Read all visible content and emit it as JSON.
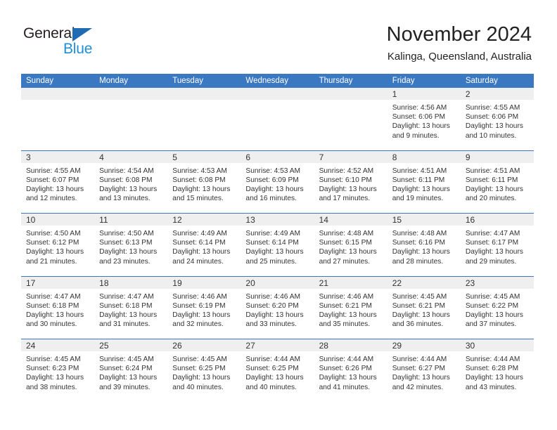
{
  "brand": {
    "name_top": "General",
    "name_bottom": "Blue",
    "triangle_icon": "brand-triangle-icon",
    "color_dark": "#231f20",
    "color_blue": "#1f8fd8"
  },
  "header": {
    "title": "November 2024",
    "subtitle": "Kalinga, Queensland, Australia"
  },
  "theme": {
    "header_blue": "#3a78c2",
    "date_strip_gray": "#efefef",
    "text": "#333333"
  },
  "weekdays": [
    "Sunday",
    "Monday",
    "Tuesday",
    "Wednesday",
    "Thursday",
    "Friday",
    "Saturday"
  ],
  "weeks": [
    [
      {
        "day": "",
        "empty": true
      },
      {
        "day": "",
        "empty": true
      },
      {
        "day": "",
        "empty": true
      },
      {
        "day": "",
        "empty": true
      },
      {
        "day": "",
        "empty": true
      },
      {
        "day": "1",
        "sunrise": "Sunrise: 4:56 AM",
        "sunset": "Sunset: 6:06 PM",
        "daylight": "Daylight: 13 hours and 9 minutes."
      },
      {
        "day": "2",
        "sunrise": "Sunrise: 4:55 AM",
        "sunset": "Sunset: 6:06 PM",
        "daylight": "Daylight: 13 hours and 10 minutes."
      }
    ],
    [
      {
        "day": "3",
        "sunrise": "Sunrise: 4:55 AM",
        "sunset": "Sunset: 6:07 PM",
        "daylight": "Daylight: 13 hours and 12 minutes."
      },
      {
        "day": "4",
        "sunrise": "Sunrise: 4:54 AM",
        "sunset": "Sunset: 6:08 PM",
        "daylight": "Daylight: 13 hours and 13 minutes."
      },
      {
        "day": "5",
        "sunrise": "Sunrise: 4:53 AM",
        "sunset": "Sunset: 6:08 PM",
        "daylight": "Daylight: 13 hours and 15 minutes."
      },
      {
        "day": "6",
        "sunrise": "Sunrise: 4:53 AM",
        "sunset": "Sunset: 6:09 PM",
        "daylight": "Daylight: 13 hours and 16 minutes."
      },
      {
        "day": "7",
        "sunrise": "Sunrise: 4:52 AM",
        "sunset": "Sunset: 6:10 PM",
        "daylight": "Daylight: 13 hours and 17 minutes."
      },
      {
        "day": "8",
        "sunrise": "Sunrise: 4:51 AM",
        "sunset": "Sunset: 6:11 PM",
        "daylight": "Daylight: 13 hours and 19 minutes."
      },
      {
        "day": "9",
        "sunrise": "Sunrise: 4:51 AM",
        "sunset": "Sunset: 6:11 PM",
        "daylight": "Daylight: 13 hours and 20 minutes."
      }
    ],
    [
      {
        "day": "10",
        "sunrise": "Sunrise: 4:50 AM",
        "sunset": "Sunset: 6:12 PM",
        "daylight": "Daylight: 13 hours and 21 minutes."
      },
      {
        "day": "11",
        "sunrise": "Sunrise: 4:50 AM",
        "sunset": "Sunset: 6:13 PM",
        "daylight": "Daylight: 13 hours and 23 minutes."
      },
      {
        "day": "12",
        "sunrise": "Sunrise: 4:49 AM",
        "sunset": "Sunset: 6:14 PM",
        "daylight": "Daylight: 13 hours and 24 minutes."
      },
      {
        "day": "13",
        "sunrise": "Sunrise: 4:49 AM",
        "sunset": "Sunset: 6:14 PM",
        "daylight": "Daylight: 13 hours and 25 minutes."
      },
      {
        "day": "14",
        "sunrise": "Sunrise: 4:48 AM",
        "sunset": "Sunset: 6:15 PM",
        "daylight": "Daylight: 13 hours and 27 minutes."
      },
      {
        "day": "15",
        "sunrise": "Sunrise: 4:48 AM",
        "sunset": "Sunset: 6:16 PM",
        "daylight": "Daylight: 13 hours and 28 minutes."
      },
      {
        "day": "16",
        "sunrise": "Sunrise: 4:47 AM",
        "sunset": "Sunset: 6:17 PM",
        "daylight": "Daylight: 13 hours and 29 minutes."
      }
    ],
    [
      {
        "day": "17",
        "sunrise": "Sunrise: 4:47 AM",
        "sunset": "Sunset: 6:18 PM",
        "daylight": "Daylight: 13 hours and 30 minutes."
      },
      {
        "day": "18",
        "sunrise": "Sunrise: 4:47 AM",
        "sunset": "Sunset: 6:18 PM",
        "daylight": "Daylight: 13 hours and 31 minutes."
      },
      {
        "day": "19",
        "sunrise": "Sunrise: 4:46 AM",
        "sunset": "Sunset: 6:19 PM",
        "daylight": "Daylight: 13 hours and 32 minutes."
      },
      {
        "day": "20",
        "sunrise": "Sunrise: 4:46 AM",
        "sunset": "Sunset: 6:20 PM",
        "daylight": "Daylight: 13 hours and 33 minutes."
      },
      {
        "day": "21",
        "sunrise": "Sunrise: 4:46 AM",
        "sunset": "Sunset: 6:21 PM",
        "daylight": "Daylight: 13 hours and 35 minutes."
      },
      {
        "day": "22",
        "sunrise": "Sunrise: 4:45 AM",
        "sunset": "Sunset: 6:21 PM",
        "daylight": "Daylight: 13 hours and 36 minutes."
      },
      {
        "day": "23",
        "sunrise": "Sunrise: 4:45 AM",
        "sunset": "Sunset: 6:22 PM",
        "daylight": "Daylight: 13 hours and 37 minutes."
      }
    ],
    [
      {
        "day": "24",
        "sunrise": "Sunrise: 4:45 AM",
        "sunset": "Sunset: 6:23 PM",
        "daylight": "Daylight: 13 hours and 38 minutes."
      },
      {
        "day": "25",
        "sunrise": "Sunrise: 4:45 AM",
        "sunset": "Sunset: 6:24 PM",
        "daylight": "Daylight: 13 hours and 39 minutes."
      },
      {
        "day": "26",
        "sunrise": "Sunrise: 4:45 AM",
        "sunset": "Sunset: 6:25 PM",
        "daylight": "Daylight: 13 hours and 40 minutes."
      },
      {
        "day": "27",
        "sunrise": "Sunrise: 4:44 AM",
        "sunset": "Sunset: 6:25 PM",
        "daylight": "Daylight: 13 hours and 40 minutes."
      },
      {
        "day": "28",
        "sunrise": "Sunrise: 4:44 AM",
        "sunset": "Sunset: 6:26 PM",
        "daylight": "Daylight: 13 hours and 41 minutes."
      },
      {
        "day": "29",
        "sunrise": "Sunrise: 4:44 AM",
        "sunset": "Sunset: 6:27 PM",
        "daylight": "Daylight: 13 hours and 42 minutes."
      },
      {
        "day": "30",
        "sunrise": "Sunrise: 4:44 AM",
        "sunset": "Sunset: 6:28 PM",
        "daylight": "Daylight: 13 hours and 43 minutes."
      }
    ]
  ]
}
